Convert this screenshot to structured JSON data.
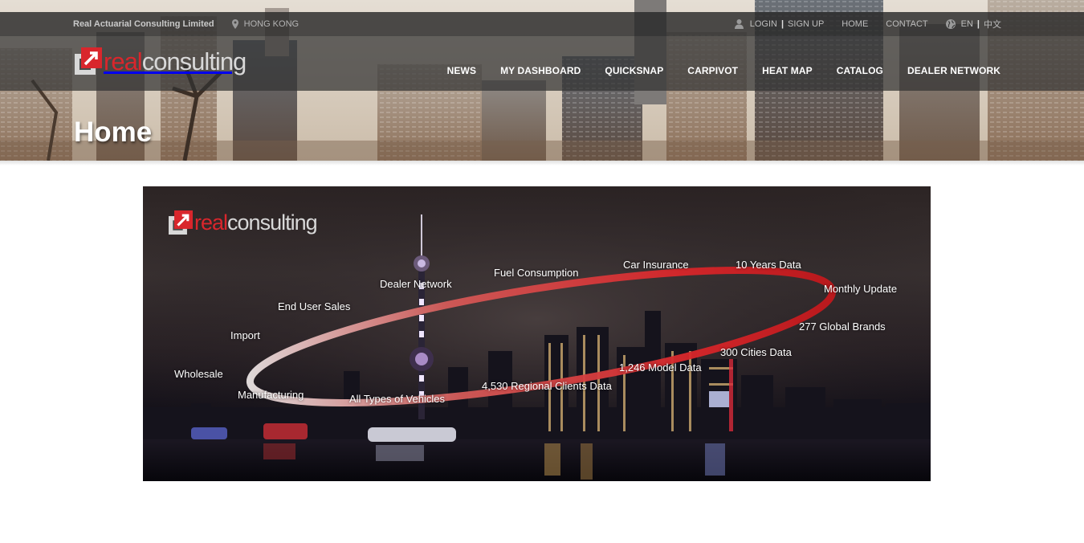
{
  "topbar": {
    "company": "Real Actuarial Consulting Limited",
    "location": "HONG KONG",
    "login": "LOGIN",
    "signup": "SIGN UP",
    "home": "HOME",
    "contact": "CONTACT",
    "lang_en": "EN",
    "lang_zh": "中文"
  },
  "logo": {
    "part1": "real",
    "part2": "consulting"
  },
  "nav": [
    "NEWS",
    "MY DASHBOARD",
    "QUICKSNAP",
    "CARPIVOT",
    "HEAT MAP",
    "CATALOG",
    "DEALER NETWORK"
  ],
  "page_title": "Home",
  "banner": {
    "logo_part1": "real",
    "logo_part2": "consulting",
    "labels": [
      "Wholesale",
      "Import",
      "End User Sales",
      "Dealer Network",
      "Fuel Consumption",
      "Car Insurance",
      "10 Years Data",
      "Monthly Update",
      "277 Global Brands",
      "300 Cities Data",
      "1,246 Model Data",
      "4,530 Regional Clients Data",
      "All Types of Vehicles",
      "Manufacturing"
    ]
  },
  "colors": {
    "accent": "#d9262c",
    "topbar": "#282828",
    "nav_text": "#ffffff"
  },
  "icons": [
    "map-marker-icon",
    "user-icon",
    "globe-icon",
    "logo-mark-icon"
  ]
}
